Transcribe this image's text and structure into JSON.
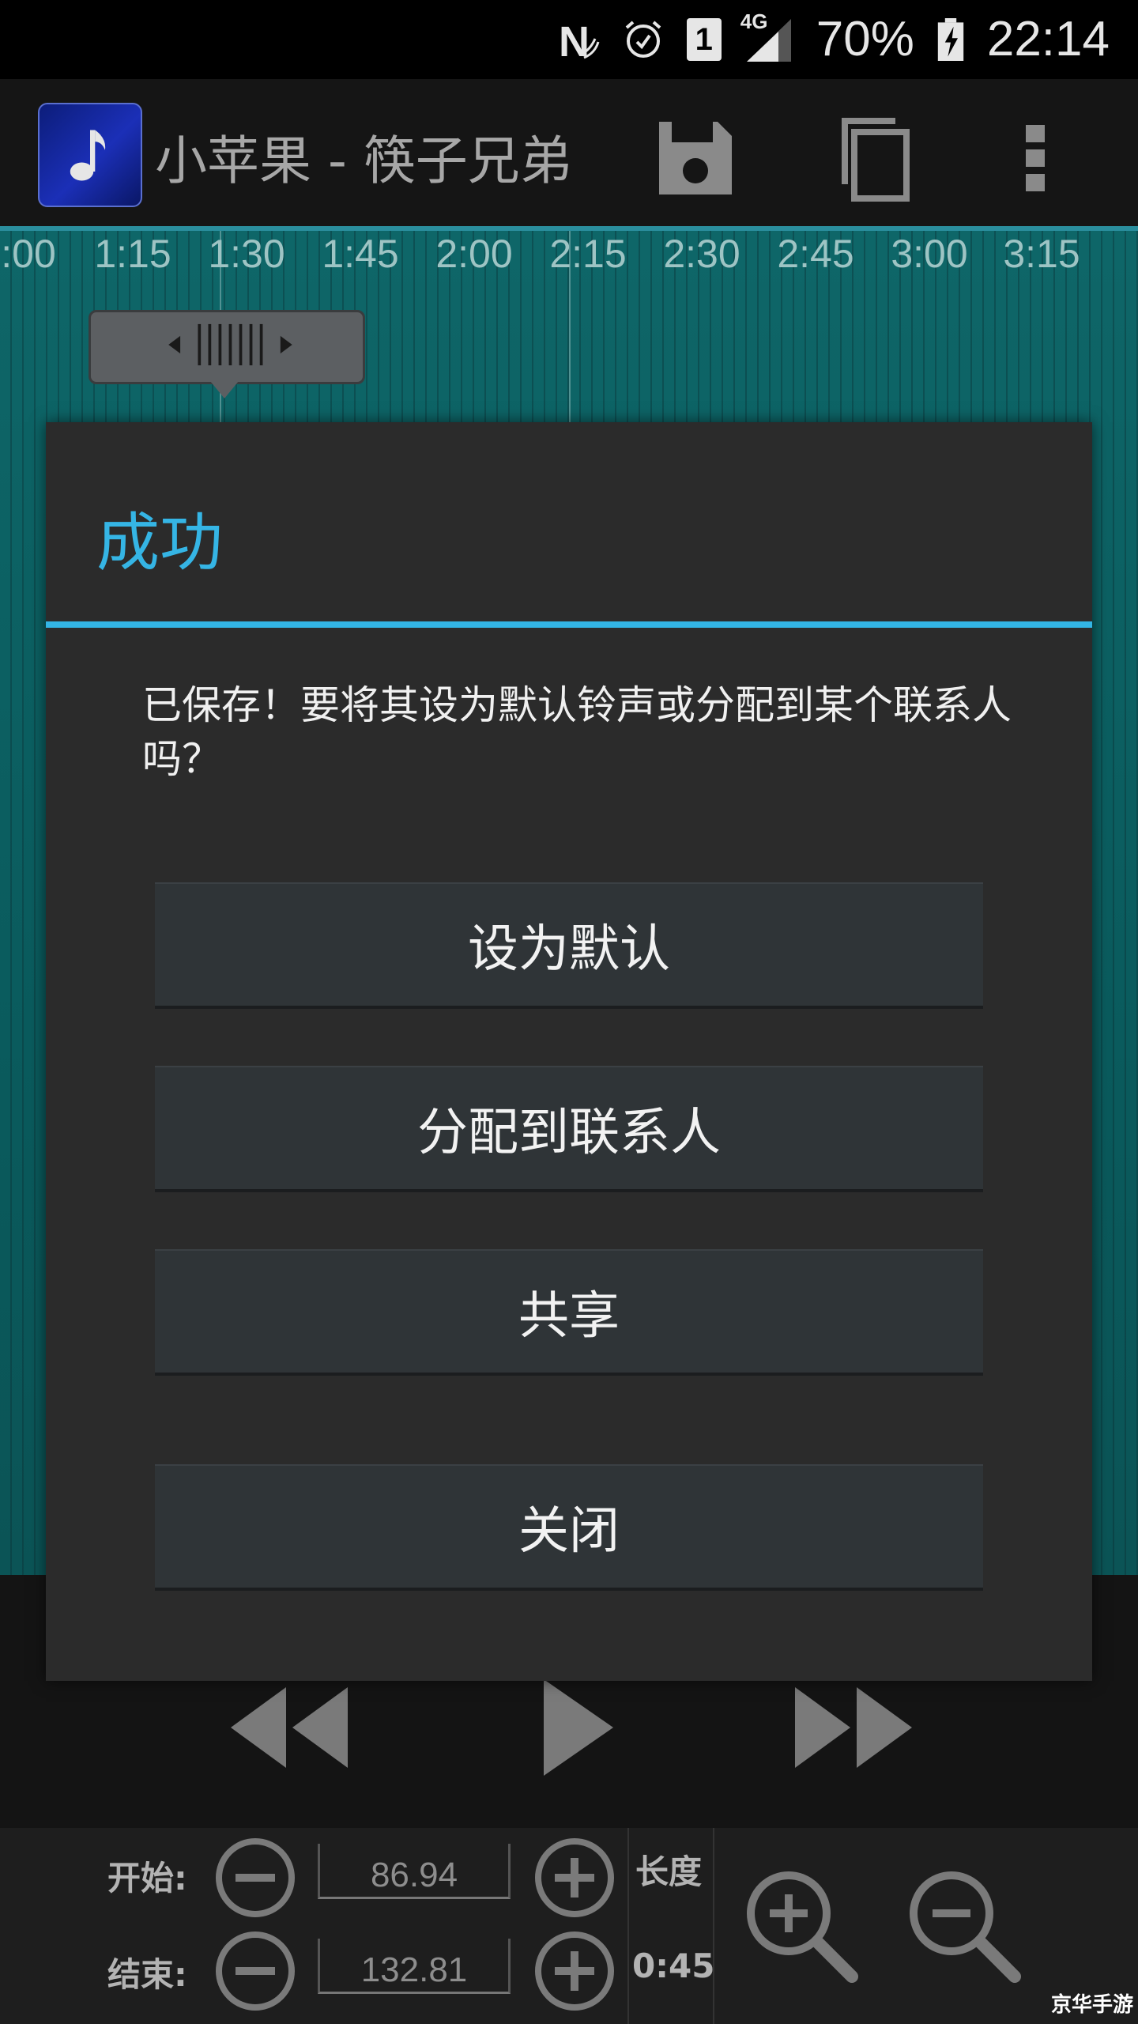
{
  "status_bar": {
    "battery": "70%",
    "time": "22:14",
    "network": "4G",
    "sim": "1",
    "icons": [
      "nfc-icon",
      "alarm-icon",
      "sim-1-icon",
      "signal-icon",
      "battery-charging-icon"
    ]
  },
  "action_bar": {
    "title": "小苹果 - 筷子兄弟",
    "icons": [
      "music-note-icon",
      "save-icon",
      "copy-icon",
      "overflow-menu-icon"
    ]
  },
  "timeline": {
    "ticks": [
      ":00",
      "1:15",
      "1:30",
      "1:45",
      "2:00",
      "2:15",
      "2:30",
      "2:45",
      "3:00",
      "3:15"
    ]
  },
  "dialog": {
    "title": "成功",
    "message": "已保存！要将其设为默认铃声或分配到某个联系人吗？",
    "buttons": {
      "set_default": "设为默认",
      "assign_contact": "分配到联系人",
      "share": "共享",
      "close": "关闭"
    }
  },
  "controls": {
    "start_label": "开始:",
    "end_label": "结束:",
    "start_value": "86.94",
    "end_value": "132.81",
    "length_label": "长度",
    "length_value": "0:45",
    "icons": [
      "rewind-icon",
      "play-icon",
      "fast-forward-icon",
      "minus-icon",
      "plus-icon",
      "zoom-in-icon",
      "zoom-out-icon"
    ]
  },
  "watermark": "京华手游"
}
